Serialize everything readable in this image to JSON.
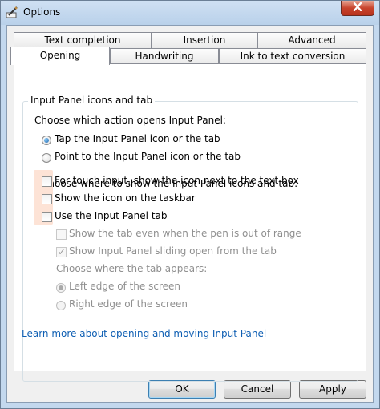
{
  "window": {
    "title": "Options"
  },
  "tabs_row1": [
    "Text completion",
    "Insertion",
    "Advanced"
  ],
  "tabs_row2": [
    "Opening",
    "Handwriting",
    "Ink to text conversion"
  ],
  "group": {
    "title": "Input Panel icons and tab",
    "action_prompt": "Choose which action opens Input Panel:",
    "radios": [
      {
        "label": "Tap the Input Panel icon or the tab",
        "checked": true
      },
      {
        "label": "Point to the Input Panel icon or the tab",
        "checked": false
      }
    ],
    "show_prompt": "Choose where to show the Input Panel icons and tab:",
    "checkboxes": [
      {
        "label": "For touch input, show the icon next to the text box",
        "checked": false
      },
      {
        "label": "Show the icon on the taskbar",
        "checked": false
      },
      {
        "label": "Use the Input Panel tab",
        "checked": false
      }
    ],
    "sub_checkboxes": [
      {
        "label": "Show the tab even when the pen is out of range",
        "checked": false
      },
      {
        "label": "Show Input Panel sliding open from the tab",
        "checked": true
      }
    ],
    "tab_position_prompt": "Choose where the tab appears:",
    "tab_position_radios": [
      {
        "label": "Left edge of the screen",
        "checked": true
      },
      {
        "label": "Right edge of the screen",
        "checked": false
      }
    ]
  },
  "link": "Learn more about opening and moving Input Panel",
  "buttons": {
    "ok": "OK",
    "cancel": "Cancel",
    "apply": "Apply"
  },
  "colors": {
    "accent_link": "#0f5fb3",
    "close_button": "#c8442d",
    "highlight": "#fde3d6"
  }
}
